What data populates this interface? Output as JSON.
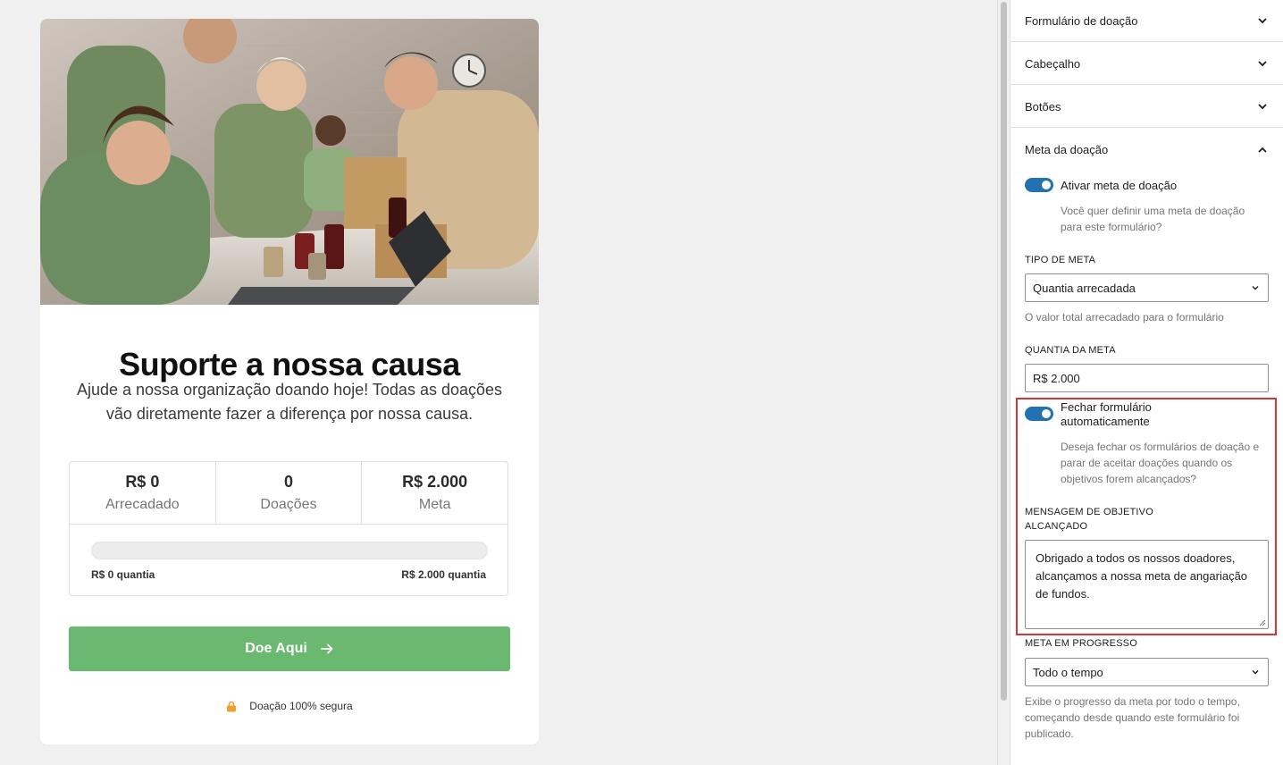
{
  "preview": {
    "hero_image_alt": "",
    "title": "Suporte a nossa causa",
    "subtitle": "Ajude a nossa organização doando hoje! Todas as doações vão diretamente fazer a diferença por nossa causa.",
    "stats": [
      {
        "value": "R$ 0",
        "label": "Arrecadado"
      },
      {
        "value": "0",
        "label": "Doações"
      },
      {
        "value": "R$ 2.000",
        "label": "Meta"
      }
    ],
    "progress_fraction": 0,
    "amount_left": "R$ 0 quantia",
    "amount_right": "R$ 2.000 quantia",
    "donate_label": "Doe Aqui",
    "secure_label": "Doação 100% segura"
  },
  "sidebar": {
    "panels": [
      {
        "title": "Formulário de doação",
        "expanded": false
      },
      {
        "title": "Cabeçalho",
        "expanded": false
      },
      {
        "title": "Botões",
        "expanded": false
      },
      {
        "title": "Meta da doação",
        "expanded": true
      }
    ],
    "enable_goal": {
      "label": "Ativar meta de doação",
      "on": true,
      "help": "Você quer definir uma meta de doação para este formulário?"
    },
    "goal_type": {
      "label": "TIPO DE META",
      "value": "Quantia arrecadada",
      "help": "O valor total arrecadado para o formulário"
    },
    "goal_amount": {
      "label": "QUANTIA DA META",
      "value": "R$ 2.000"
    },
    "auto_close": {
      "label": "Fechar formulário automaticamente",
      "on": true,
      "help": "Deseja fechar os formulários de doação e parar de aceitar doações quando os objetivos forem alcançados?"
    },
    "achieved_message": {
      "label": "MENSAGEM DE OBJETIVO ALCANÇADO",
      "value": "Obrigado a todos os nossos doadores, alcançamos a nossa meta de angariação de fundos."
    },
    "goal_progress": {
      "label": "META EM PROGRESSO",
      "value": "Todo o tempo",
      "help": "Exibe o progresso da meta por todo o tempo, começando desde quando este formulário foi publicado."
    }
  },
  "colors": {
    "accent": "#2271b1",
    "donate_button": "#6bb870",
    "highlight": "#d63638",
    "lock_icon": "#f0a030"
  }
}
